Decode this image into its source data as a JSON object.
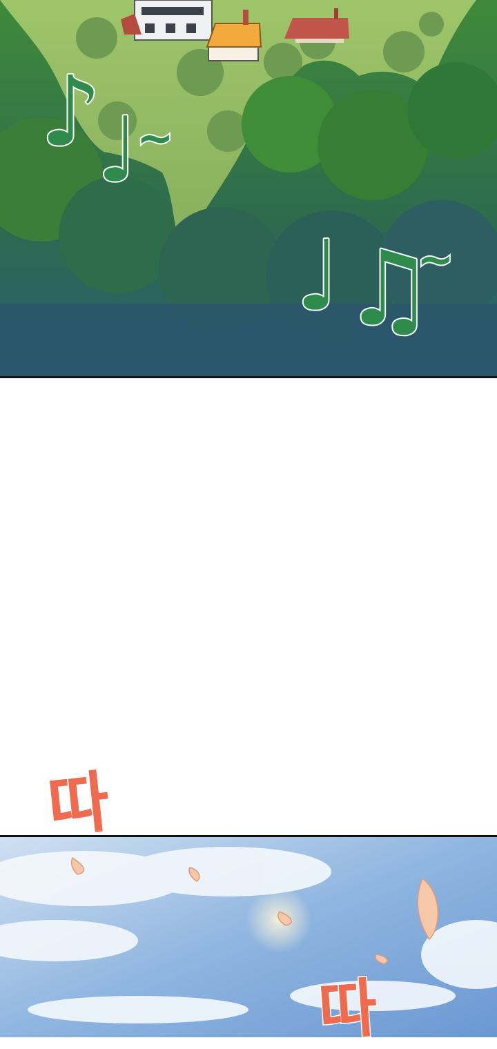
{
  "panels": {
    "forest": {
      "music_notes": [
        "♪",
        "♩",
        "~",
        "♩",
        "♫",
        "~"
      ]
    },
    "sky": {
      "sound_effects": [
        "따",
        "따"
      ]
    }
  },
  "colors": {
    "note_fill": "#2e8b4c",
    "note_outline": "#ffffff",
    "sfx": "#ef6b4f",
    "panel_border": "#111111"
  }
}
